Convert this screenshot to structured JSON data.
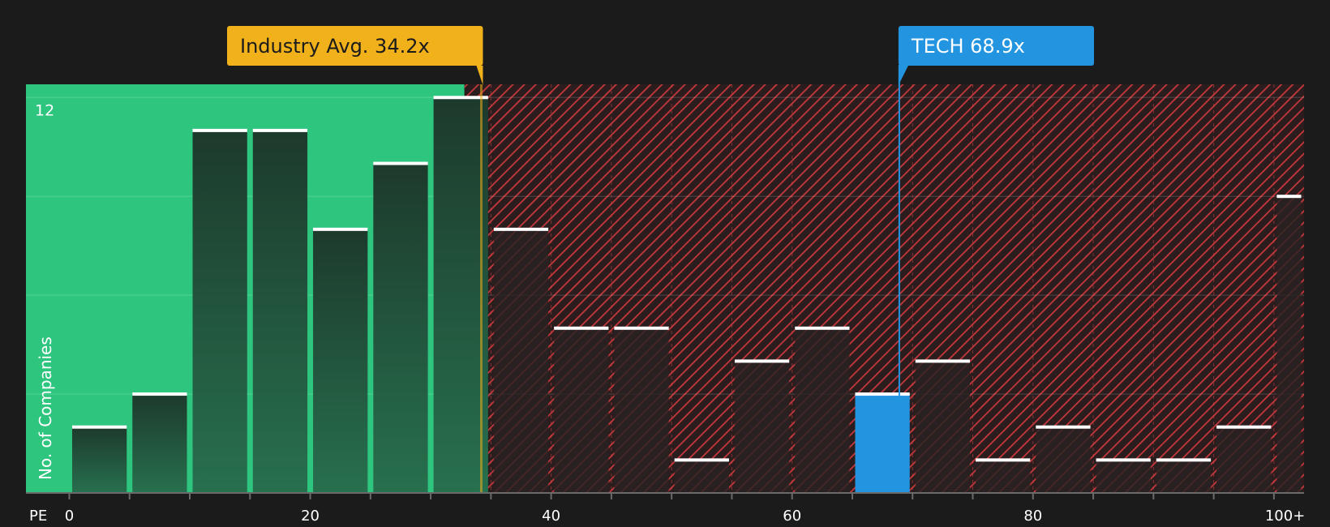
{
  "chart_data": {
    "type": "bar",
    "x_label": "PE",
    "y_label": "No. of Companies",
    "x_ticks": [
      {
        "value": 0,
        "label": "0"
      },
      {
        "value": 20,
        "label": "20"
      },
      {
        "value": 40,
        "label": "40"
      },
      {
        "value": 60,
        "label": "60"
      },
      {
        "value": 80,
        "label": "80"
      },
      {
        "value": 100,
        "label": "100+"
      }
    ],
    "y_ticks": [
      {
        "value": 12,
        "label": "12"
      }
    ],
    "ylim": [
      0,
      12.4
    ],
    "xlim": [
      -3.6,
      102.5
    ],
    "bin_width": 5,
    "bins": [
      {
        "start": 0,
        "count": 2
      },
      {
        "start": 5,
        "count": 3
      },
      {
        "start": 10,
        "count": 11
      },
      {
        "start": 15,
        "count": 11
      },
      {
        "start": 20,
        "count": 8
      },
      {
        "start": 25,
        "count": 10
      },
      {
        "start": 30,
        "count": 12
      },
      {
        "start": 35,
        "count": 8
      },
      {
        "start": 40,
        "count": 5
      },
      {
        "start": 45,
        "count": 5
      },
      {
        "start": 50,
        "count": 1
      },
      {
        "start": 55,
        "count": 4
      },
      {
        "start": 60,
        "count": 5
      },
      {
        "start": 65,
        "count": 3
      },
      {
        "start": 70,
        "count": 4
      },
      {
        "start": 75,
        "count": 1
      },
      {
        "start": 80,
        "count": 2
      },
      {
        "start": 85,
        "count": 1
      },
      {
        "start": 90,
        "count": 1
      },
      {
        "start": 95,
        "count": 2
      },
      {
        "start": 100,
        "count": 9
      }
    ],
    "industry_avg": {
      "value": 34.2,
      "label": "Industry Avg. 34.2x"
    },
    "company": {
      "value": 68.9,
      "label": "TECH 68.9x"
    },
    "fair_value_boundary": 32.8,
    "colors": {
      "background": "#1b1b1b",
      "undervalued": "#2ec67f",
      "overvalued": "#c8383c",
      "bar_green": "#1f3d30",
      "bar_red": "#2a2222",
      "company_bar": "#2394e0",
      "industry_marker": "#f0b11b",
      "bar_cap": "#ffffff"
    }
  }
}
